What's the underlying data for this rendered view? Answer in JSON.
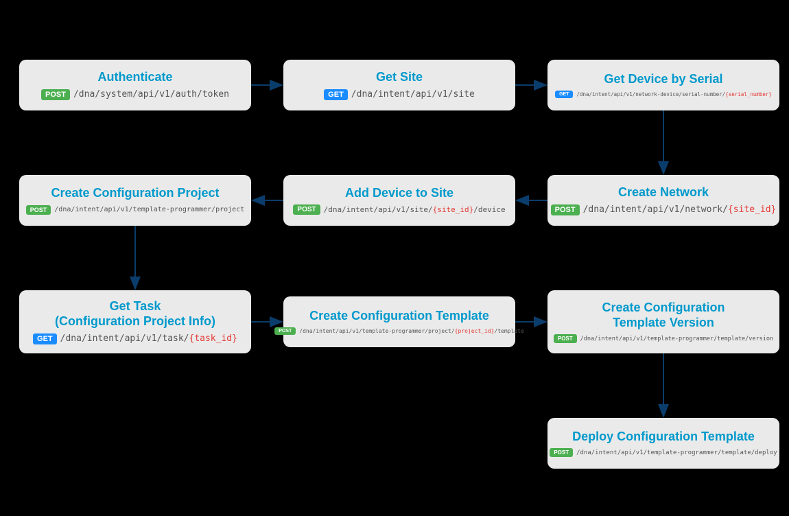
{
  "nodes": {
    "n1": {
      "title": "Authenticate",
      "method": "POST",
      "path": "/dna/system/api/v1/auth/token",
      "param": ""
    },
    "n2": {
      "title": "Get Site",
      "method": "GET",
      "path": "/dna/intent/api/v1/site",
      "param": ""
    },
    "n3": {
      "title": "Get Device by Serial",
      "method": "GET",
      "path_pre": "/dna/intent/api/v1/network-device/serial-number/",
      "param": "{serial_number}"
    },
    "n4": {
      "title": "Create Network",
      "method": "POST",
      "path_pre": "/dna/intent/api/v1/network/",
      "param": "{site_id}"
    },
    "n5": {
      "title": "Add Device to Site",
      "method": "POST",
      "path_pre": "/dna/intent/api/v1/site/",
      "param": "{site_id}",
      "path_post": "/device"
    },
    "n6": {
      "title": "Create Configuration Project",
      "method": "POST",
      "path": "/dna/intent/api/v1/template-programmer/project",
      "param": ""
    },
    "n7": {
      "title": "Get Task\n(Configuration Project Info)",
      "method": "GET",
      "path_pre": "/dna/intent/api/v1/task/",
      "param": "{task_id}"
    },
    "n8": {
      "title": "Create Configuration Template",
      "method": "POST",
      "path_pre": "/dna/intent/api/v1/template-programmer/project/",
      "param": "{project_id}",
      "path_post": "/template"
    },
    "n9": {
      "title": "Create Configuration\nTemplate Version",
      "method": "POST",
      "path": "/dna/intent/api/v1/template-programmer/template/version",
      "param": ""
    },
    "n10": {
      "title": "Deploy Configuration Template",
      "method": "POST",
      "path": "/dna/intent/api/v1/template-programmer/template/deploy",
      "param": ""
    }
  }
}
